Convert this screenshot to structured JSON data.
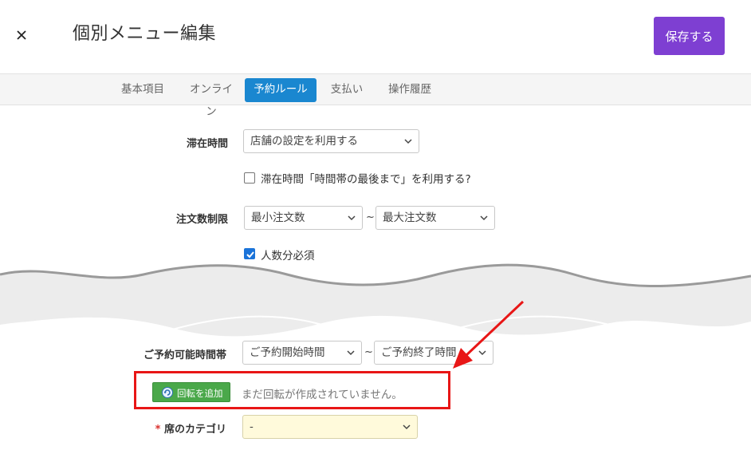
{
  "header": {
    "close_label": "×",
    "title": "個別メニュー編集",
    "save_label": "保存する"
  },
  "tabs": [
    {
      "label": "基本項目",
      "active": false
    },
    {
      "label": "オンライン",
      "active": false
    },
    {
      "label": "予約ルール",
      "active": true
    },
    {
      "label": "支払い",
      "active": false
    },
    {
      "label": "操作履歴",
      "active": false
    }
  ],
  "form": {
    "stay_time": {
      "label": "滞在時間",
      "value": "店舗の設定を利用する",
      "checkbox_label": "滞在時間「時間帯の最後まで」を利用する?",
      "checkbox_checked": false
    },
    "order_limit": {
      "label": "注文数制限",
      "min_value": "最小注文数",
      "separator": "~",
      "max_value": "最大注文数",
      "checkbox_label": "人数分必須",
      "checkbox_checked": true
    },
    "booking_time": {
      "label": "ご予約可能時間帯",
      "start_value": "ご予約開始時間",
      "separator": "~",
      "end_value": "ご予約終了時間"
    },
    "rotation": {
      "button_label": "回転を追加",
      "empty_text": "まだ回転が作成されていません。"
    },
    "seat_category": {
      "required_mark": "*",
      "label": "席のカテゴリ",
      "value": "-"
    }
  },
  "colors": {
    "accent_purple": "#7e3fd2",
    "tab_active": "#1a87d0",
    "button_green": "#4aa84a",
    "highlight_red": "#e81616",
    "checkbox_blue": "#1a73d9",
    "select_yellow": "#fffadb"
  }
}
